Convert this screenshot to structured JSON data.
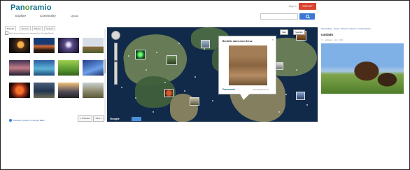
{
  "header": {
    "logo_part1": "Pan",
    "logo_part2": "o",
    "logo_part3": "ramio",
    "nav": [
      "Explore",
      "Community"
    ],
    "upload_label": "Upload",
    "sign_in_label": "Sign in",
    "sign_up_label": "SIGN UP",
    "search_placeholder": ""
  },
  "left_panel": {
    "tabs": [
      "Popular",
      "Recent",
      "Places",
      "Upload"
    ],
    "google_earth_checkbox": "Also show photos not selected for Google Earth",
    "pager_prev": "« Previous",
    "pager_next": "Next »",
    "earth_link": "Panoramio photos in Google Earth"
  },
  "map": {
    "google_label": "Google",
    "map_type_map": "Map",
    "map_type_satellite": "Satellite"
  },
  "popup": {
    "title": "Berbérie dans mon Grenz",
    "brand": "Panoramio",
    "credit": "www.panoramio.com"
  },
  "right_panel": {
    "breadcrumb": "World Maps › Spain › Rincón Cultural › Ciudad Muela",
    "title": "cuidado",
    "meta": "© ... uploaded ... pics · 2021"
  },
  "colors": {
    "brand": "#0e6d8a",
    "brand_accent": "#57a21d",
    "signup": "#d9432f",
    "search_button": "#3a78d4",
    "ocean": "#112a4a"
  }
}
